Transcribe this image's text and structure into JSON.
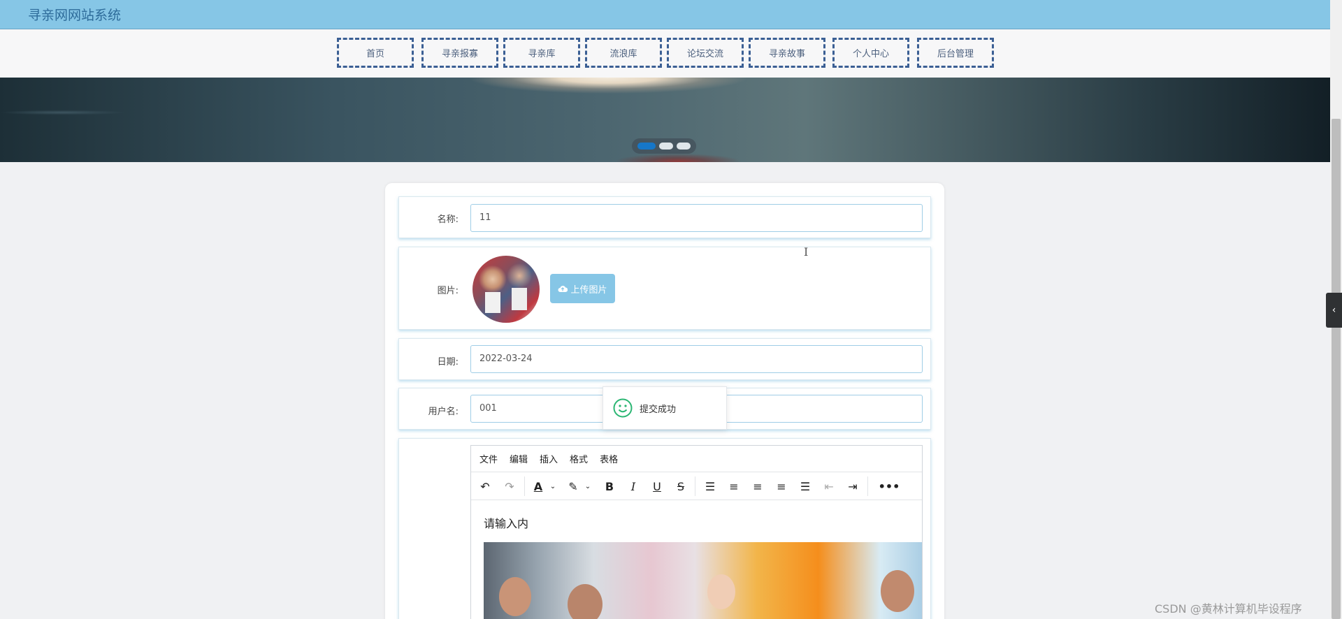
{
  "header": {
    "site_title": "寻亲网网站系统"
  },
  "nav": {
    "items": [
      {
        "label": "首页"
      },
      {
        "label": "寻亲报寡"
      },
      {
        "label": "寻亲库"
      },
      {
        "label": "流浪库"
      },
      {
        "label": "论坛交流"
      },
      {
        "label": "寻亲故事"
      },
      {
        "label": "个人中心"
      },
      {
        "label": "后台管理"
      }
    ]
  },
  "carousel": {
    "active_index": 0,
    "count": 3
  },
  "form": {
    "name_label": "名称:",
    "name_value": "11",
    "image_label": "图片:",
    "upload_label": "上传图片",
    "date_label": "日期:",
    "date_value": "2022-03-24",
    "username_label": "用户名:",
    "username_value": "001"
  },
  "toast": {
    "message": "提交成功"
  },
  "editor": {
    "menus": [
      "文件",
      "编辑",
      "插入",
      "格式",
      "表格"
    ],
    "placeholder": "请输入内",
    "tools": [
      "undo-icon",
      "redo-icon",
      "font-color-icon",
      "highlight-icon",
      "bold-icon",
      "italic-icon",
      "underline-icon",
      "strikethrough-icon",
      "line-height-icon",
      "align-left-icon",
      "align-center-icon",
      "align-right-icon",
      "justify-icon",
      "outdent-icon",
      "indent-icon",
      "more-icon"
    ]
  },
  "watermark": {
    "text": "CSDN @黄林计算机毕设程序"
  },
  "colors": {
    "topbar": "#86c6e6",
    "nav_border": "#3b5f94",
    "accent": "#86c6e6",
    "toast_icon": "#2bb673"
  }
}
